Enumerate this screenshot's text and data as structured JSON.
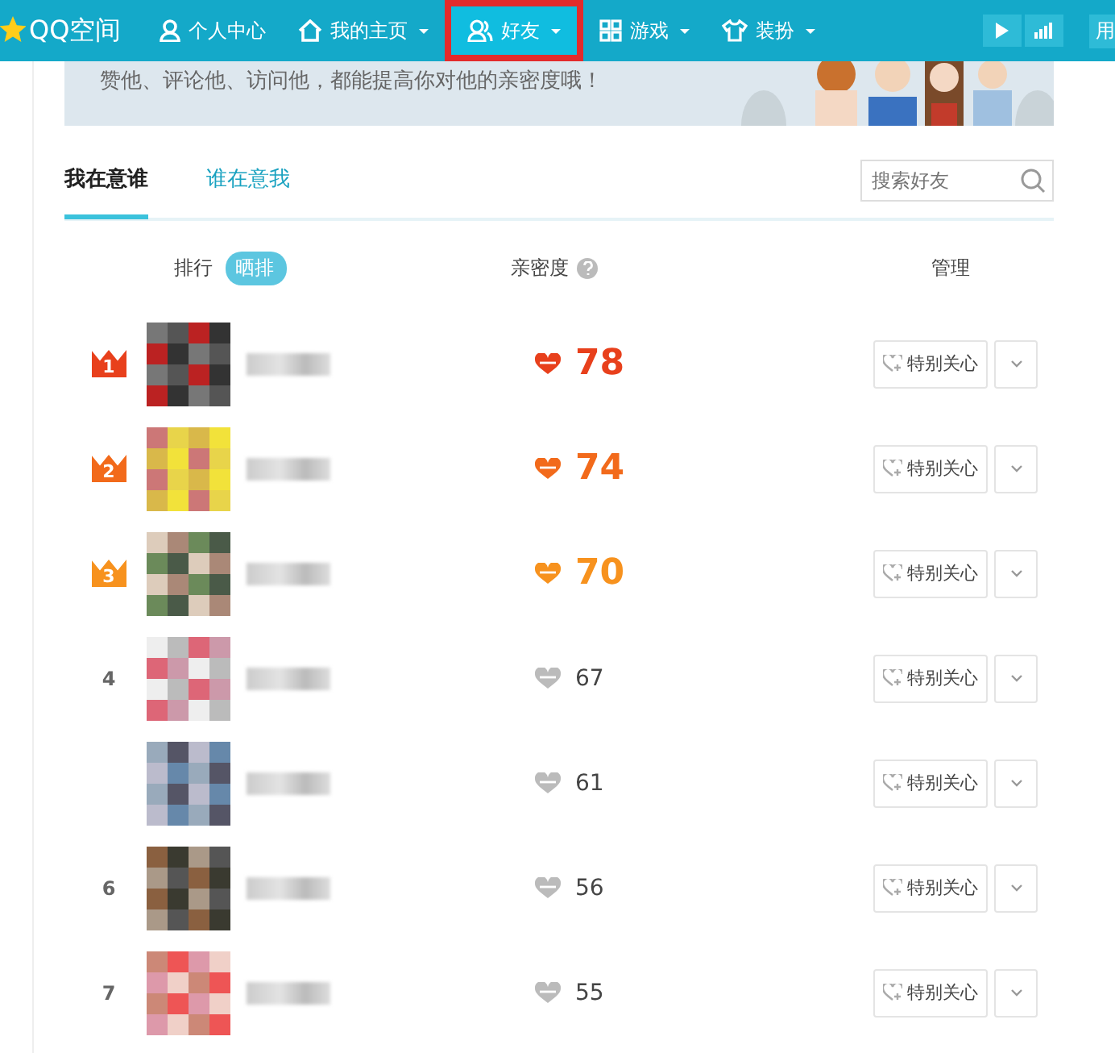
{
  "topbar": {
    "logo": "QQ空间",
    "nav": [
      {
        "label": "个人中心",
        "caret": false,
        "selected": false,
        "highlighted": false
      },
      {
        "label": "我的主页",
        "caret": true,
        "selected": false,
        "highlighted": false
      },
      {
        "label": "好友",
        "caret": true,
        "selected": true,
        "highlighted": true
      },
      {
        "label": "游戏",
        "caret": true,
        "selected": false,
        "highlighted": false
      },
      {
        "label": "装扮",
        "caret": true,
        "selected": false,
        "highlighted": false
      }
    ],
    "right_text": "用"
  },
  "banner": {
    "text": "赞他、评论他、访问他，都能提高你对他的亲密度哦！"
  },
  "tabs": [
    {
      "label": "我在意谁",
      "selected": true
    },
    {
      "label": "谁在意我",
      "selected": false
    }
  ],
  "search": {
    "placeholder": "搜索好友"
  },
  "header": {
    "rank": "排行",
    "toggle": "晒排",
    "intimacy": "亲密度",
    "manage": "管理"
  },
  "rows": [
    {
      "rank": "1",
      "kind": "top",
      "color": "#e8401c",
      "score": "78",
      "button": "特别关心"
    },
    {
      "rank": "2",
      "kind": "top",
      "color": "#f26a1b",
      "score": "74",
      "button": "特别关心"
    },
    {
      "rank": "3",
      "kind": "top",
      "color": "#f7921e",
      "score": "70",
      "button": "特别关心"
    },
    {
      "rank": "4",
      "kind": "normal",
      "score": "67",
      "button": "特别关心"
    },
    {
      "kind": "normal",
      "score": "61",
      "button": "特别关心"
    },
    {
      "rank": "6",
      "kind": "normal",
      "score": "56",
      "button": "特别关心"
    },
    {
      "rank": "7",
      "kind": "normal",
      "score": "55",
      "button": "特别关心"
    }
  ]
}
